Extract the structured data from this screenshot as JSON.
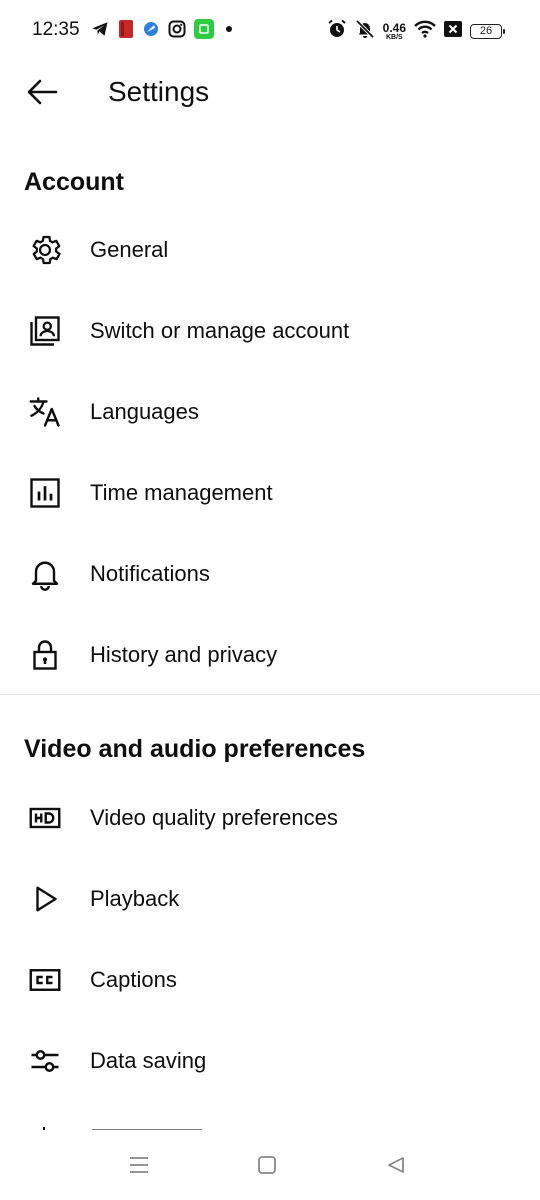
{
  "status_bar": {
    "time": "12:35",
    "left_icons": [
      "telegram-icon",
      "red-app-icon",
      "blue-app-icon",
      "instagram-icon",
      "green-app-icon",
      "dot-icon"
    ],
    "right_icons": [
      "alarm-icon",
      "bell-muted-icon",
      "wifi-icon",
      "x-box-icon"
    ],
    "net_speed_value": "0.46",
    "net_speed_unit": "KB/S",
    "battery": "26"
  },
  "app_bar": {
    "back_icon": "arrow-left-icon",
    "title": "Settings"
  },
  "sections": [
    {
      "title": "Account",
      "items": [
        {
          "label": "General",
          "icon": "gear-icon"
        },
        {
          "label": "Switch or manage account",
          "icon": "account-switch-icon"
        },
        {
          "label": "Languages",
          "icon": "translate-icon"
        },
        {
          "label": "Time management",
          "icon": "bar-chart-icon"
        },
        {
          "label": "Notifications",
          "icon": "bell-icon"
        },
        {
          "label": "History and privacy",
          "icon": "lock-icon"
        }
      ]
    },
    {
      "title": "Video and audio preferences",
      "items": [
        {
          "label": "Video quality preferences",
          "icon": "hd-icon"
        },
        {
          "label": "Playback",
          "icon": "play-icon"
        },
        {
          "label": "Captions",
          "icon": "cc-icon"
        },
        {
          "label": "Data saving",
          "icon": "sliders-icon"
        }
      ]
    }
  ],
  "nav_bar": {
    "buttons": [
      "menu-icon",
      "home-square-icon",
      "back-triangle-icon"
    ]
  },
  "colors": {
    "background": "#ffffff",
    "text": "#0f0f0f",
    "divider": "#e3e3e3"
  }
}
